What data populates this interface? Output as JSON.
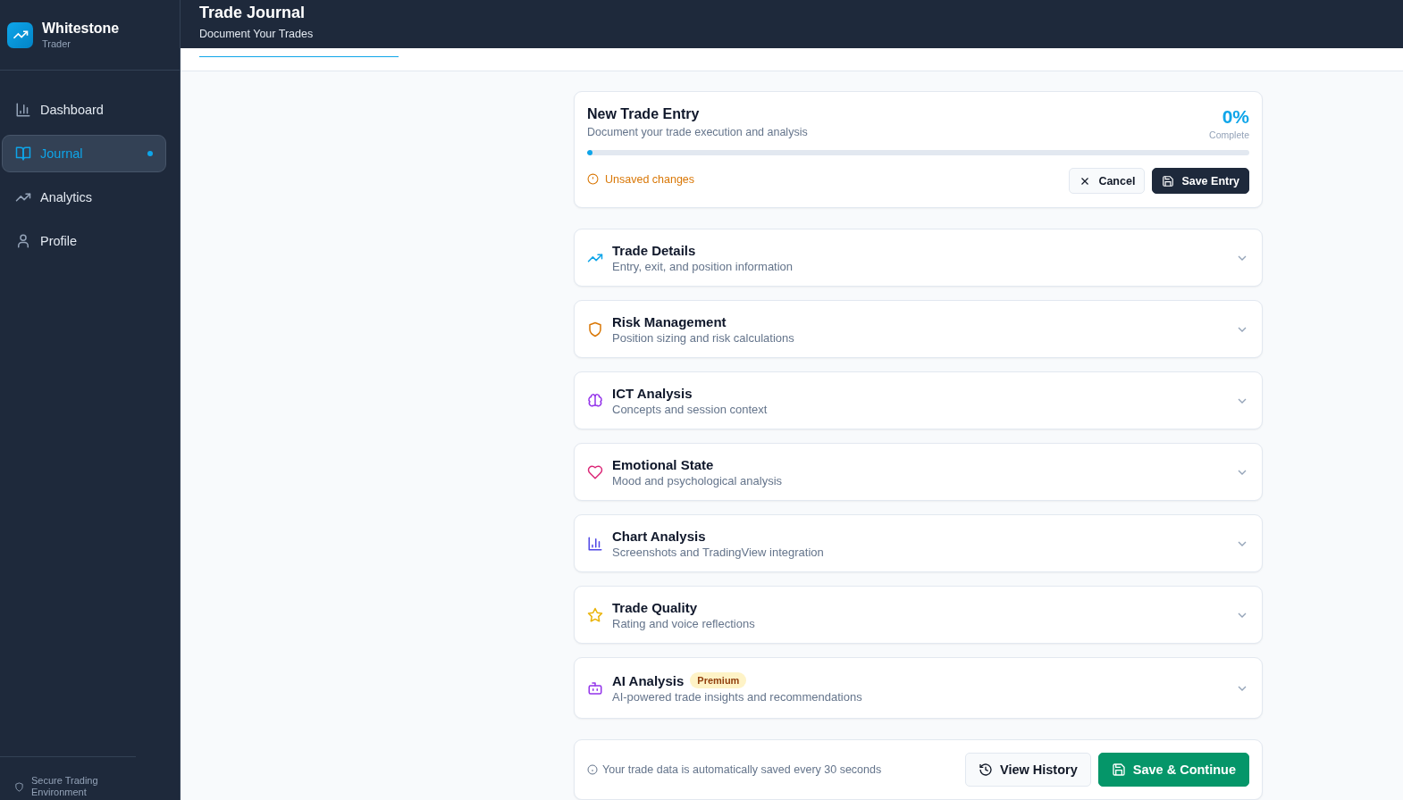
{
  "brand": {
    "name": "Whitestone",
    "subtitle": "Trader"
  },
  "nav": [
    {
      "label": "Dashboard",
      "kind": "bars",
      "selected": false
    },
    {
      "label": "Journal",
      "kind": "book",
      "selected": true
    },
    {
      "label": "Analytics",
      "kind": "trend",
      "selected": false
    },
    {
      "label": "Profile",
      "kind": "user",
      "selected": false
    }
  ],
  "sidebar_footer": "Secure Trading Environment",
  "header": {
    "title": "Trade Journal",
    "subtitle": "Document Your Trades"
  },
  "entry": {
    "title": "New Trade Entry",
    "subtitle": "Document your trade execution and analysis",
    "percent": "0%",
    "percent_label": "Complete",
    "level": 0,
    "status": "Unsaved changes",
    "cancel": "Cancel",
    "save": "Save Entry"
  },
  "sections": [
    {
      "title": "Trade Details",
      "subtitle": "Entry, exit, and position information",
      "kind": "trend",
      "expanded": false
    },
    {
      "title": "Risk Management",
      "subtitle": "Position sizing and risk calculations",
      "kind": "shield",
      "expanded": false
    },
    {
      "title": "ICT Analysis",
      "subtitle": "Concepts and session context",
      "kind": "brain",
      "expanded": false
    },
    {
      "title": "Emotional State",
      "subtitle": "Mood and psychological analysis",
      "kind": "heart",
      "expanded": false
    },
    {
      "title": "Chart Analysis",
      "subtitle": "Screenshots and TradingView integration",
      "kind": "chart",
      "expanded": false
    },
    {
      "title": "Trade Quality",
      "subtitle": "Rating and voice reflections",
      "kind": "star",
      "expanded": false
    },
    {
      "title": "AI Analysis",
      "subtitle": "AI-powered trade insights and recommendations",
      "kind": "bot",
      "badge": "Premium",
      "expanded": false
    }
  ],
  "footer": {
    "note": "Your trade data is automatically saved every 30 seconds",
    "history": "View History",
    "continue": "Save & Continue"
  }
}
